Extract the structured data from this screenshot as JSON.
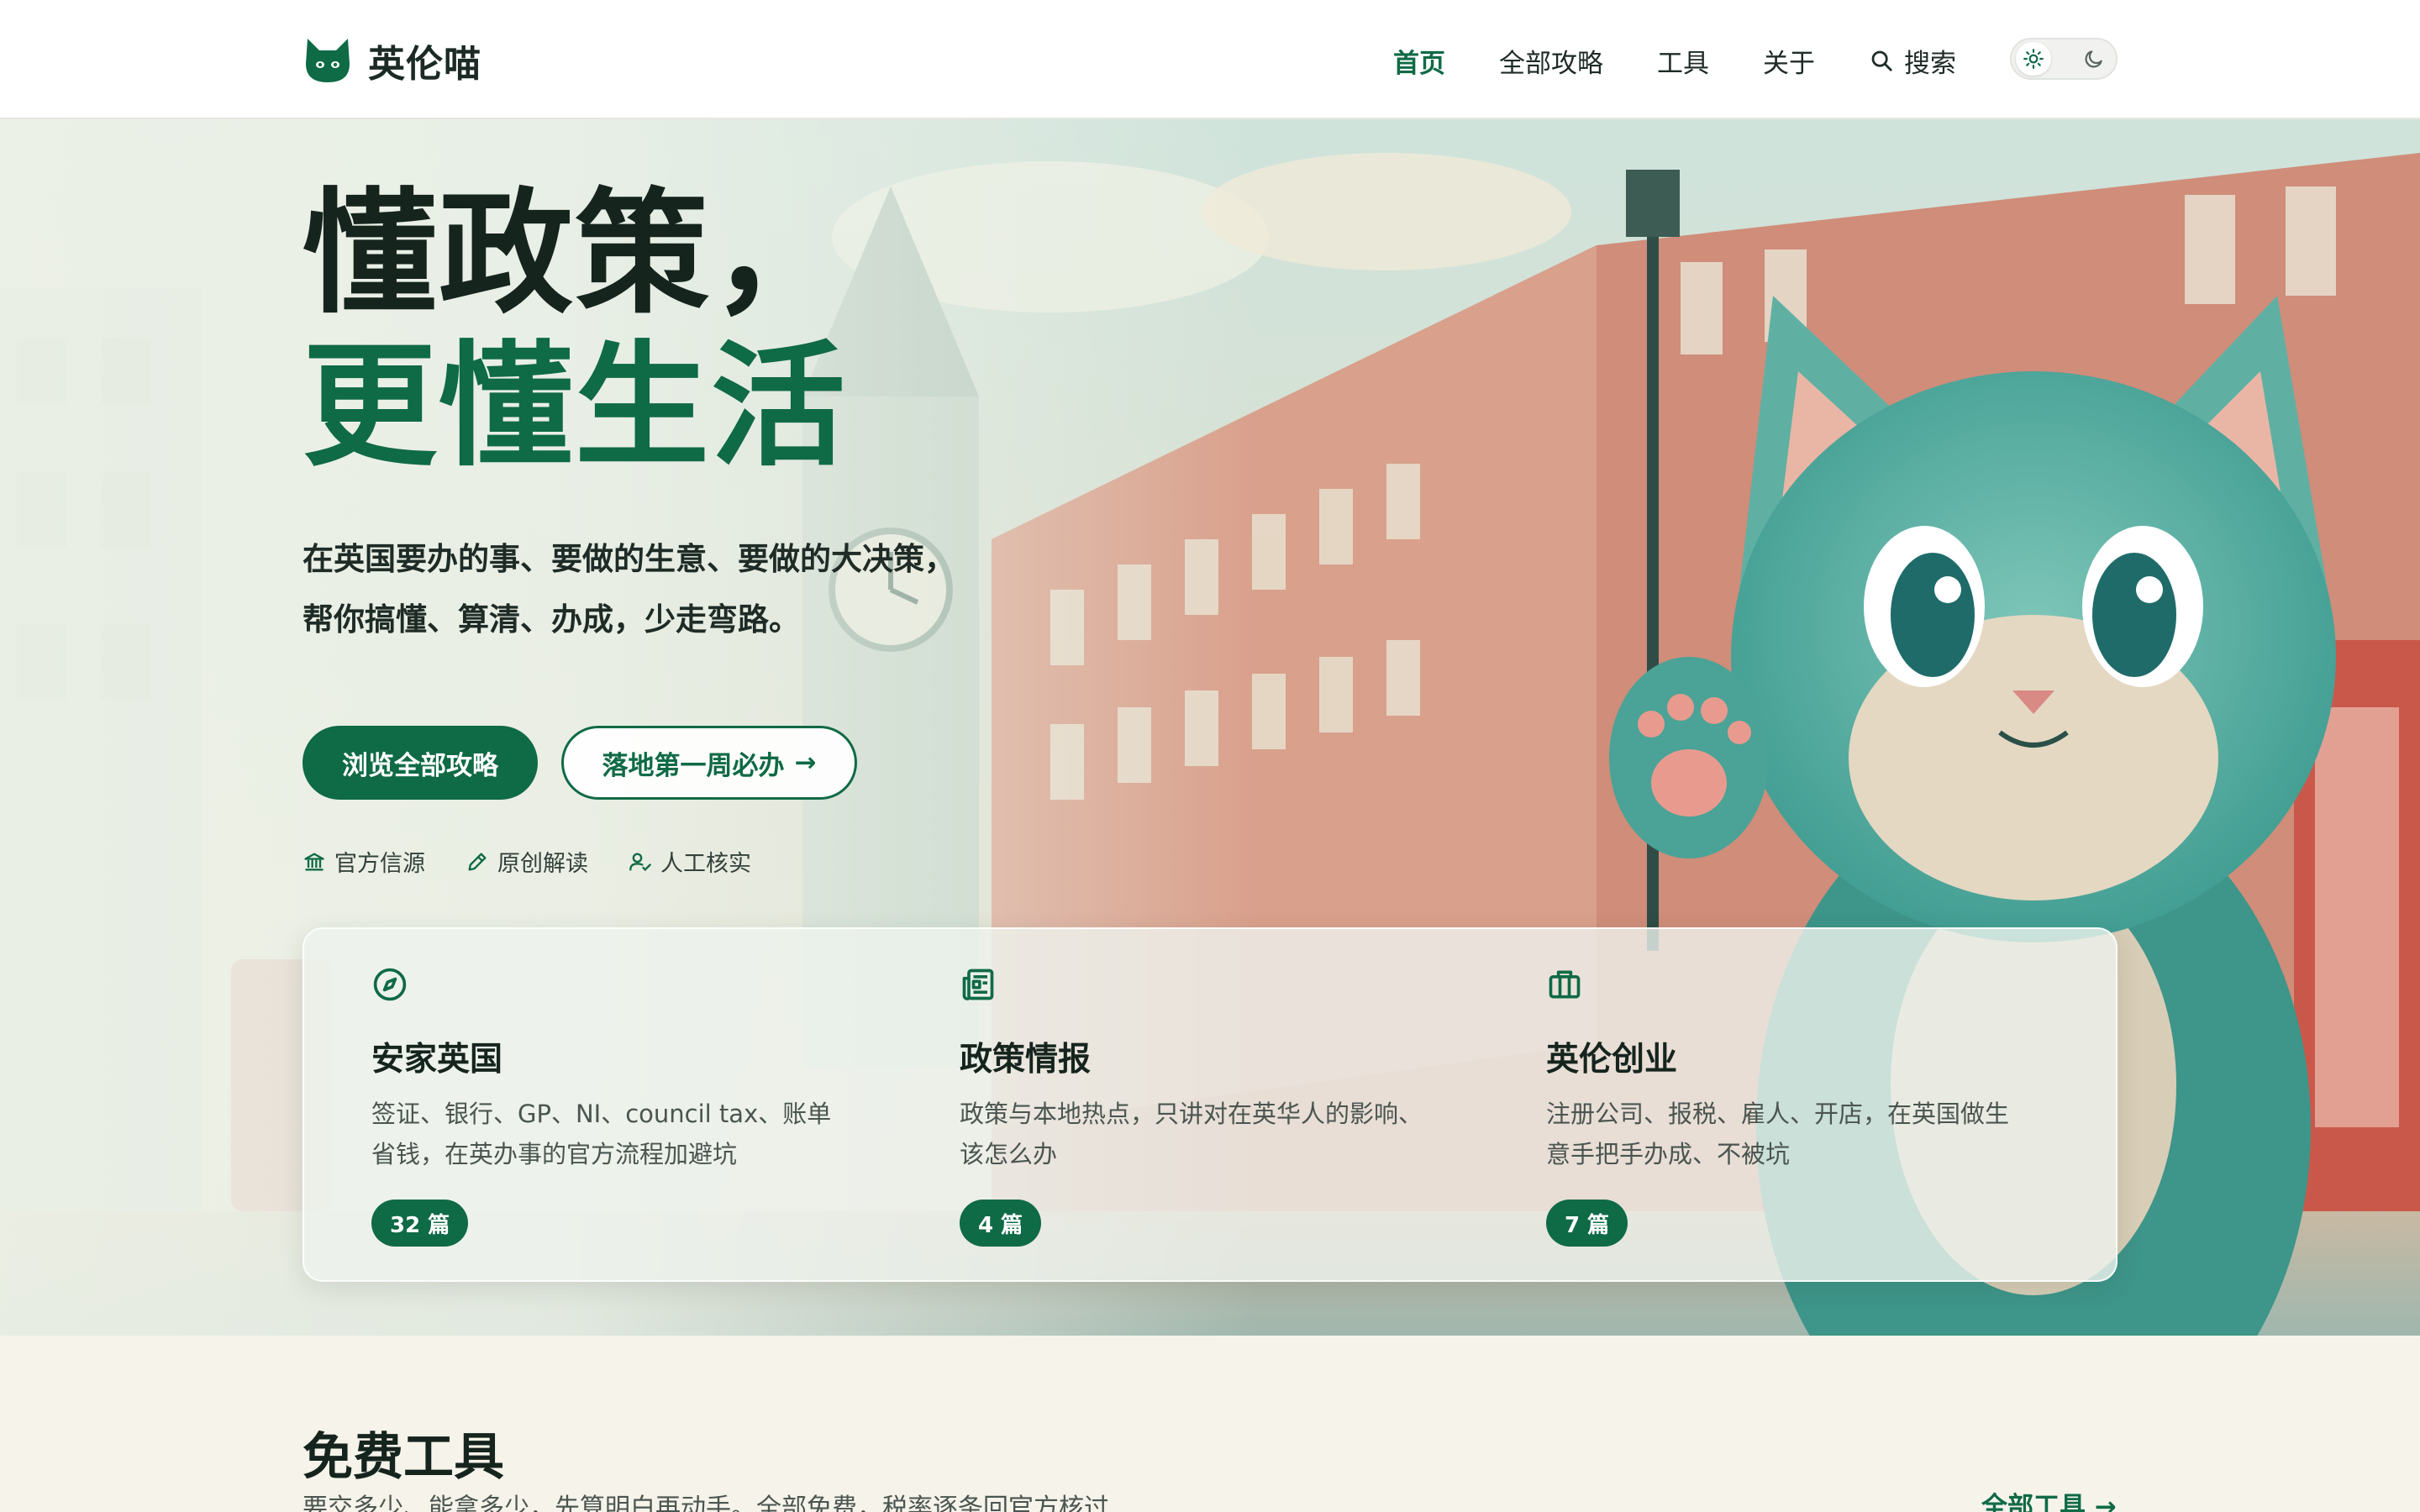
{
  "header": {
    "brand_name": "英伦喵",
    "nav": {
      "home": "首页",
      "guides": "全部攻略",
      "tools": "工具",
      "about": "关于",
      "search": "搜索"
    },
    "theme_toggle": {
      "light_icon": "sun-icon",
      "dark_icon": "moon-icon",
      "selected": "light"
    }
  },
  "hero": {
    "headline_line1": "懂政策，",
    "headline_line2": "更懂生活",
    "subtitle_line1": "在英国要办的事、要做的生意、要做的大决策，",
    "subtitle_line2": "帮你搞懂、算清、办成，少走弯路。",
    "primary_button": "浏览全部攻略",
    "secondary_button": "落地第一周必办",
    "secondary_arrow": "→",
    "badges": [
      {
        "icon": "bank-icon",
        "label": "官方信源"
      },
      {
        "icon": "pen-icon",
        "label": "原创解读"
      },
      {
        "icon": "user-check-icon",
        "label": "人工核实"
      }
    ]
  },
  "categories": [
    {
      "icon": "compass-icon",
      "title": "安家英国",
      "desc": "签证、银行、GP、NI、council tax、账单省钱，在英办事的官方流程加避坑",
      "count": "32 篇"
    },
    {
      "icon": "newspaper-icon",
      "title": "政策情报",
      "desc": "政策与本地热点，只讲对在英华人的影响、该怎么办",
      "count": "4 篇"
    },
    {
      "icon": "briefcase-icon",
      "title": "英伦创业",
      "desc": "注册公司、报税、雇人、开店，在英国做生意手把手办成、不被坑",
      "count": "7 篇"
    }
  ],
  "tools_section": {
    "title": "免费工具",
    "subtitle": "要交多少、能拿多少，先算明白再动手。全部免费，税率逐条回官方核过",
    "all_link": "全部工具 →"
  },
  "colors": {
    "brand_green": "#0f6a46",
    "text_dark": "#16241e",
    "page_bg": "#f5f3ea"
  }
}
